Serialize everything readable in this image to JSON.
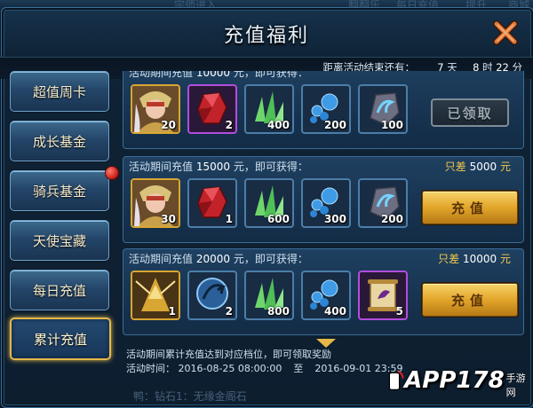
{
  "background": {
    "top_ghost_texts": [
      "宗师进入",
      "翻翻乐",
      "每日充值",
      "提升",
      "商城"
    ],
    "bottom_ghost_text": "鸭：钻石1：无缘金阁石"
  },
  "window": {
    "title": "充值福利",
    "close_icon": "close-x-icon",
    "countdown": {
      "label": "距离活动结束还有：",
      "days_value": "7",
      "days_unit": "天",
      "hours_value": "8",
      "hours_unit": "时",
      "minutes_value": "22",
      "minutes_unit": "分"
    }
  },
  "sidebar": {
    "items": [
      {
        "label": "超值周卡",
        "active": false,
        "badge": false
      },
      {
        "label": "成长基金",
        "active": false,
        "badge": false
      },
      {
        "label": "骑兵基金",
        "active": false,
        "badge": true
      },
      {
        "label": "天使宝藏",
        "active": false,
        "badge": false
      },
      {
        "label": "每日充值",
        "active": false,
        "badge": false
      },
      {
        "label": "累计充值",
        "active": true,
        "badge": false
      }
    ]
  },
  "rows": [
    {
      "head_prefix": "活动期间充值",
      "amount": "10000",
      "head_suffix": "元，即可获得：",
      "remaining": null,
      "items": [
        {
          "icon": "hero-portrait-icon",
          "qty": "20",
          "frame": "gold"
        },
        {
          "icon": "red-gem-icon",
          "qty": "2",
          "frame": "purple"
        },
        {
          "icon": "green-crystal-icon",
          "qty": "400",
          "frame": "blue"
        },
        {
          "icon": "blue-orbs-icon",
          "qty": "200",
          "frame": "blue"
        },
        {
          "icon": "rune-stone-icon",
          "qty": "100",
          "frame": "blue"
        }
      ],
      "status": "claimed",
      "claimed_label": "已领取"
    },
    {
      "head_prefix": "活动期间充值",
      "amount": "15000",
      "head_suffix": "元，即可获得：",
      "remaining": {
        "prefix": "只差",
        "value": "5000",
        "unit": "元"
      },
      "items": [
        {
          "icon": "hero-portrait-icon",
          "qty": "30",
          "frame": "gold"
        },
        {
          "icon": "red-gem-icon",
          "qty": "1",
          "frame": "blue"
        },
        {
          "icon": "green-crystal-icon",
          "qty": "600",
          "frame": "blue"
        },
        {
          "icon": "blue-orbs-icon",
          "qty": "300",
          "frame": "blue"
        },
        {
          "icon": "rune-stone-icon",
          "qty": "200",
          "frame": "blue"
        }
      ],
      "status": "charge",
      "button_label": "充值"
    },
    {
      "head_prefix": "活动期间充值",
      "amount": "20000",
      "head_suffix": "元，即可获得：",
      "remaining": {
        "prefix": "只差",
        "value": "10000",
        "unit": "元"
      },
      "items": [
        {
          "icon": "golden-knight-icon",
          "qty": "1",
          "frame": "purple"
        },
        {
          "icon": "blue-orb-arrow-icon",
          "qty": "2",
          "frame": "blue"
        },
        {
          "icon": "green-crystal-icon",
          "qty": "800",
          "frame": "blue"
        },
        {
          "icon": "blue-orbs-icon",
          "qty": "400",
          "frame": "blue"
        },
        {
          "icon": "scroll-icon",
          "qty": "5",
          "frame": "purple"
        }
      ],
      "status": "charge",
      "button_label": "充值"
    }
  ],
  "footer": {
    "note": "活动期间累计充值达到对应档位，即可领取奖励",
    "time_label": "活动时间：",
    "start": "2016-08-25 08:00:00",
    "to": "至",
    "end": "2016-09-01 23:59"
  },
  "watermark": {
    "brand": "APP178",
    "sub": "手游网"
  },
  "colors": {
    "accent_gold": "#e6b84a",
    "panel_blue": "#173350",
    "highlight_yellow": "#f2c94c",
    "badge_red": "#c41a14"
  }
}
